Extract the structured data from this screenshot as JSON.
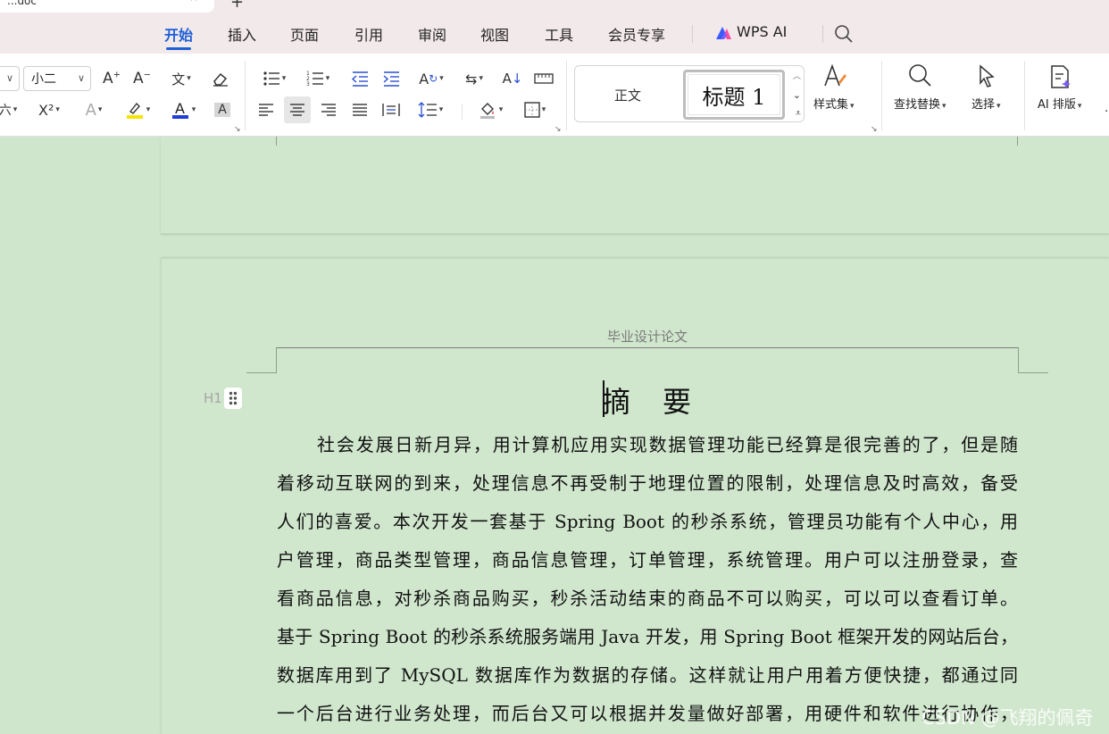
{
  "window": {
    "doc_tab_title": "...doc",
    "new_tab": "+"
  },
  "menu": {
    "tabs": [
      {
        "label": "开始",
        "active": true
      },
      {
        "label": "插入"
      },
      {
        "label": "页面"
      },
      {
        "label": "引用"
      },
      {
        "label": "审阅"
      },
      {
        "label": "视图"
      },
      {
        "label": "工具"
      },
      {
        "label": "会员专享"
      },
      {
        "label": "WPS AI"
      }
    ],
    "active_color": "#1f5fd6"
  },
  "ribbon": {
    "font_size_value": "小二",
    "styles": {
      "normal": "正文",
      "heading1": "标题  1",
      "style_set_label": "样式集"
    },
    "find_replace_label": "查找替换",
    "select_label": "选择",
    "ai_layout_label": "AI 排版",
    "superscript_label": "X²",
    "font_color": "#1f3fd6",
    "highlight_color": "#f5e400"
  },
  "document": {
    "header_text": "毕业设计论文",
    "heading_marker": "H1",
    "title": "摘　要",
    "paragraph_lines": [
      "社会发展日新月异，用计算机应用实现数据管理功能已经算是很完善的了，但是随",
      "着移动互联网的到来，处理信息不再受制于地理位置的限制，处理信息及时高效，备受",
      "人们的喜爱。本次开发一套基于 Spring Boot 的秒杀系统，管理员功能有个人中心，用",
      "户管理，商品类型管理，商品信息管理，订单管理，系统管理。用户可以注册登录，查",
      "看商品信息，对秒杀商品购买，秒杀活动结束的商品不可以购买，可以可以查看订单。",
      "基于 Spring Boot 的秒杀系统服务端用 Java 开发，用 Spring Boot 框架开发的网站后台，",
      "数据库用到了 MySQL 数据库作为数据的存储。这样就让用户用着方便快捷，都通过同",
      "一个后台进行业务处理，而后台又可以根据并发量做好部署，用硬件和软件进行协作，"
    ]
  },
  "watermark": "CSDN @飞翔的佩奇",
  "colors": {
    "canvas_bg": "#cfe6cc",
    "tab_strip_bg": "#f2e9ea"
  }
}
